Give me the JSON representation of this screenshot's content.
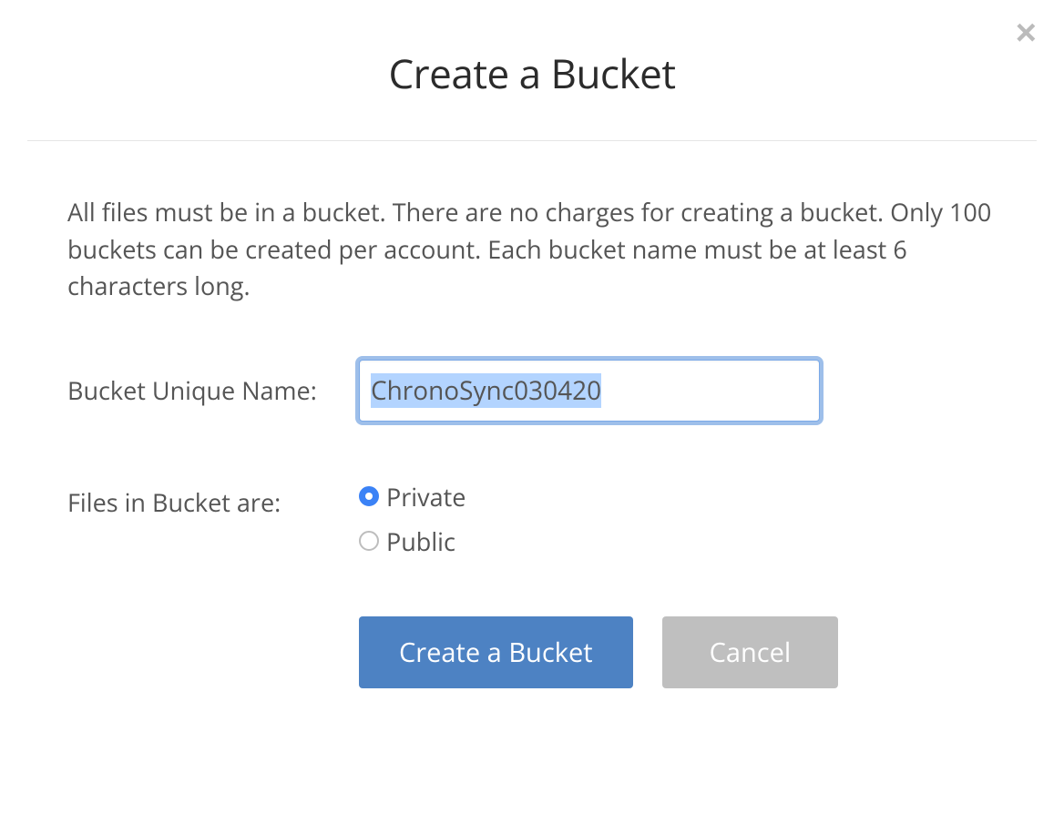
{
  "dialog": {
    "title": "Create a Bucket",
    "description": "All files must be in a bucket. There are no charges for creating a bucket. Only 100 buckets can be created per account. Each bucket name must be at least 6 characters long.",
    "close_aria": "Close"
  },
  "form": {
    "bucket_name_label": "Bucket Unique Name:",
    "bucket_name_value": "ChronoSync030420",
    "visibility_label": "Files in Bucket are:",
    "visibility_options": {
      "private": "Private",
      "public": "Public"
    },
    "visibility_selected": "private"
  },
  "actions": {
    "create_label": "Create a Bucket",
    "cancel_label": "Cancel"
  }
}
